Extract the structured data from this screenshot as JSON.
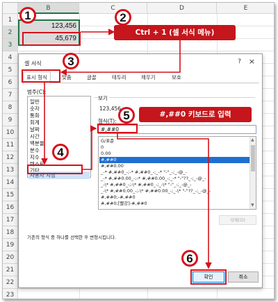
{
  "spreadsheet": {
    "columns": [
      "B",
      "C",
      "D",
      "E"
    ],
    "rows": [
      "1",
      "2",
      "3",
      "4",
      "5",
      "6",
      "7",
      "8",
      "9",
      "10",
      "11",
      "12",
      "13",
      "14",
      "15",
      "16",
      "17",
      "18",
      "19",
      "20",
      "21",
      "22",
      "23"
    ],
    "cells": {
      "b2": "123,456",
      "b3": "45,679"
    }
  },
  "dialog": {
    "title": "셀 서식",
    "help": "?",
    "close": "×",
    "tabs": [
      "표시 형식",
      "맞춤",
      "글꼴",
      "테두리",
      "채우기",
      "보호"
    ],
    "category_label": "범주(C):",
    "categories": [
      "일반",
      "숫자",
      "통화",
      "회계",
      "날짜",
      "시간",
      "백분율",
      "분수",
      "지수",
      "텍스트",
      "기타",
      "사용자 지정"
    ],
    "sample_label": "보기",
    "sample_value": "123,456",
    "type_label": "형식(T):",
    "type_value": "#,##0",
    "formats": [
      "G/표준",
      "0",
      "0.00",
      "#,##0",
      "#,##0.00",
      "_-* #,##0_-;-* #,##0_-;_-* \"-\"_-;_-@_-",
      "_-* #,##0.00_-;-* #,##0.00_-;_-* \"-\"??_-;_-@_-",
      "_-\\* #,##0_-;-\\* #,##0_-;_-\\* \"-\"_-;_-@_-",
      "_-\\* #,##0.00_-;-\\* #,##0.00_-;_-\\* \"-\"??_-;_-@_-",
      "#,##0;-#,##0",
      "#,##0;[빨강]-#,##0"
    ],
    "delete_label": "삭제(D)",
    "description": "기존의 형식 중 하나를 선택한 후 변형시킵니다.",
    "ok_label": "확인",
    "cancel_label": "취소"
  },
  "annotations": {
    "steps": [
      "1",
      "2",
      "3",
      "4",
      "5",
      "6"
    ],
    "callout_menu": "Ctrl + 1 (셀 서식 메뉴)",
    "callout_type": "#,##0 키보드로 입력",
    "accent": "#c4161c"
  }
}
